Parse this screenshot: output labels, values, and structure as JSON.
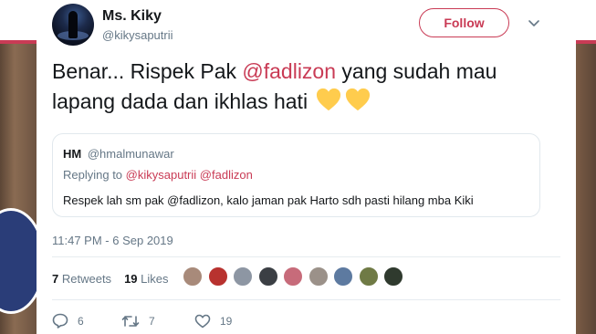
{
  "author": {
    "name": "Ms. Kiky",
    "handle": "@kikysaputrii"
  },
  "follow_label": "Follow",
  "tweet": {
    "text_before": "Benar... Rispek Pak ",
    "mention": "@fadlizon",
    "text_after": " yang sudah mau lapang dada dan ikhlas hati",
    "emoji": [
      "yellow-heart-icon",
      "yellow-heart-icon"
    ]
  },
  "quoted": {
    "name": "HM",
    "handle": "@hmalmunawar",
    "replying_label": "Replying to",
    "replying_to": [
      "@kikysaputrii",
      "@fadlizon"
    ],
    "text": "Respek lah sm pak @fadlizon, kalo jaman pak Harto sdh pasti hilang mba Kiki"
  },
  "timestamp": "11:47 PM - 6 Sep 2019",
  "stats": {
    "retweets_count": "7",
    "retweets_label": "Retweets",
    "likes_count": "19",
    "likes_label": "Likes"
  },
  "likers": [
    {
      "color": "#a88a7a"
    },
    {
      "color": "#b8322f"
    },
    {
      "color": "#8d96a3"
    },
    {
      "color": "#3b3f44"
    },
    {
      "color": "#c76b7a"
    },
    {
      "color": "#9b9189"
    },
    {
      "color": "#5d7aa0"
    },
    {
      "color": "#6f7a45"
    },
    {
      "color": "#2f3a2e"
    }
  ],
  "actions": {
    "replies": "6",
    "retweets": "7",
    "likes": "19"
  },
  "colors": {
    "accent": "#c93b55",
    "text": "#14171a",
    "secondary": "#657786",
    "heart": "#ffcc4d"
  }
}
